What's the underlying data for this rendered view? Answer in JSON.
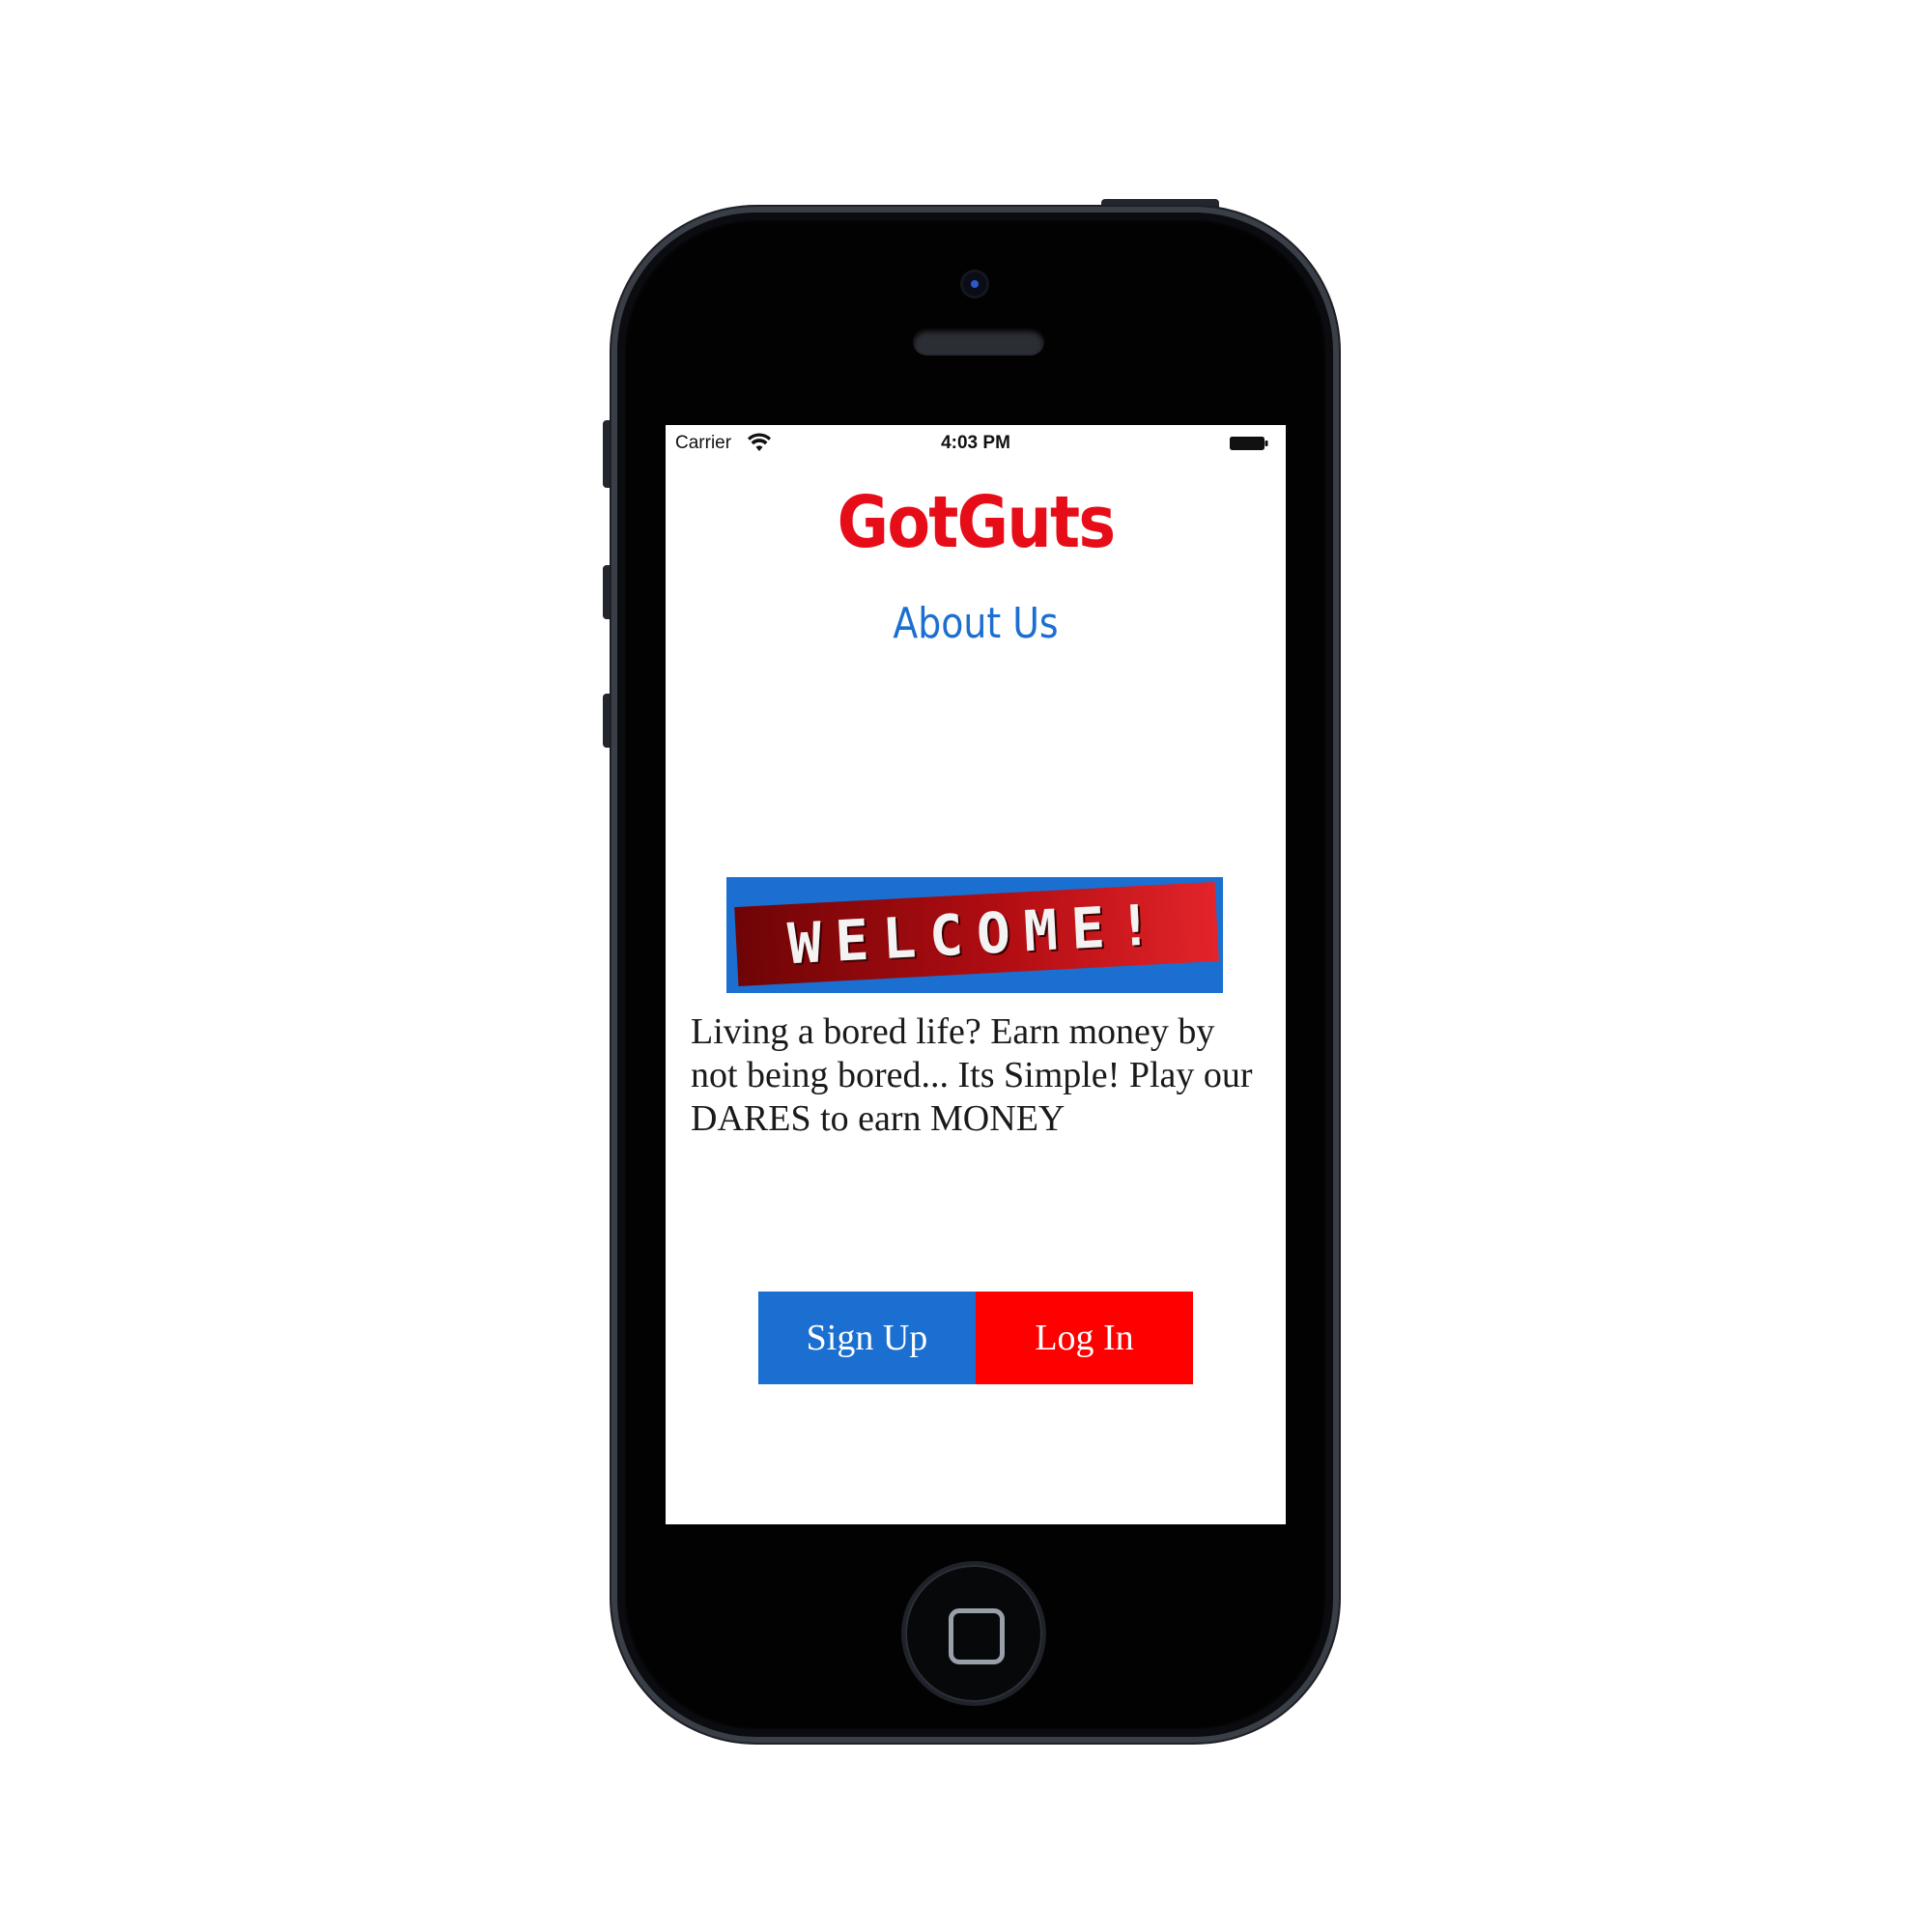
{
  "status_bar": {
    "carrier": "Carrier",
    "time": "4:03 PM",
    "wifi_icon": "wifi-icon",
    "battery_icon": "battery-icon"
  },
  "app": {
    "title": "GotGuts",
    "title_color": "#e60d18",
    "about_link": "About Us",
    "link_color": "#1c6fd1"
  },
  "welcome": {
    "banner_text": "WELCOME!",
    "banner_bg": "#1a6fd0"
  },
  "description": "Living a bored life? Earn money by not being bored... Its Simple! Play our DARES to earn MONEY",
  "buttons": {
    "sign_up": "Sign Up",
    "sign_up_color": "#1a6fd0",
    "log_in": "Log In",
    "log_in_color": "#ff0000"
  }
}
